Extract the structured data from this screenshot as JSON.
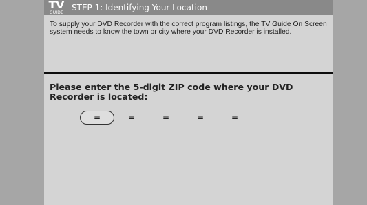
{
  "header": {
    "logo_main": "TV",
    "logo_sub": "GUIDE",
    "title": "STEP 1: Identifying Your Location"
  },
  "intro": {
    "text": "To supply your DVD Recorder with the correct program listings, the TV Guide On Screen system needs to know the town or city where your DVD Recorder is installed."
  },
  "main": {
    "prompt": "Please enter the 5-digit ZIP code where your DVD Recorder is located:"
  },
  "zip": {
    "digits": [
      "=",
      "=",
      "=",
      "=",
      "="
    ],
    "selected_index": 0
  },
  "colors": {
    "background": "#a8a8a8",
    "header": "#898989",
    "panel": "#d4d4d4",
    "divider": "#0d0d0d"
  }
}
